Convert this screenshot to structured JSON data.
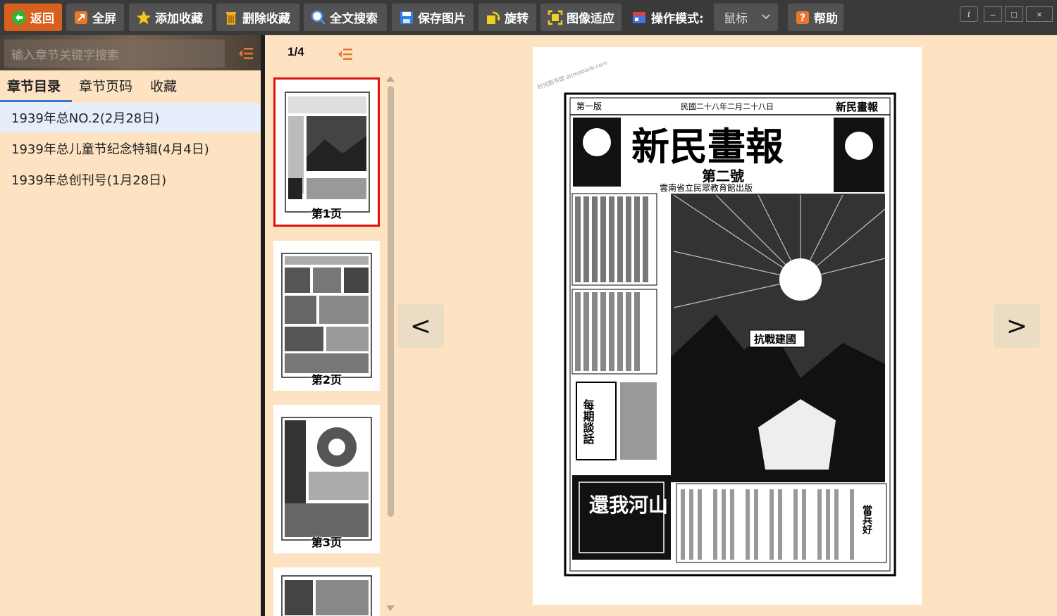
{
  "toolbar": {
    "back": "返回",
    "fullscreen": "全屏",
    "add_favorite": "添加收藏",
    "delete_favorite": "删除收藏",
    "fulltext_search": "全文搜索",
    "save_image": "保存图片",
    "rotate": "旋转",
    "fit_image": "图像适应",
    "operation_mode_label": "操作模式:",
    "operation_mode_value": "鼠标",
    "help": "帮助"
  },
  "window": {
    "info": "i",
    "minimize": "–",
    "maximize": "□",
    "close": "×"
  },
  "sidebar": {
    "search_placeholder": "输入章节关键字搜索",
    "tabs": [
      {
        "label": "章节目录",
        "active": true
      },
      {
        "label": "章节页码",
        "active": false
      },
      {
        "label": "收藏",
        "active": false
      }
    ],
    "chapters": [
      {
        "label": "1939年总NO.2(2月28日)",
        "selected": true
      },
      {
        "label": "1939年总儿童节纪念特辑(4月4日)",
        "selected": false
      },
      {
        "label": "1939年总创刊号(1月28日)",
        "selected": false
      }
    ]
  },
  "thumbnails": {
    "page_count": "1/4",
    "pages": [
      {
        "label": "第1页",
        "selected": true
      },
      {
        "label": "第2页",
        "selected": false
      },
      {
        "label": "第3页",
        "selected": false
      },
      {
        "label": "",
        "selected": false
      }
    ]
  },
  "viewer": {
    "prev": "<",
    "next": ">",
    "newspaper": {
      "masthead": "新民畫報",
      "issue": "第二號",
      "header_left": "新民畫報",
      "header_mid": "民國二十八年二月二十八日",
      "header_right": "第一版",
      "subtitle": "雲南省立民眾教育館出版",
      "banner": "抗戰建國",
      "box_title": "每期談話",
      "slogan": "還我河山",
      "column_title": "當兵好",
      "watermark": "时光图书馆 atimebook.com"
    }
  },
  "colors": {
    "toolbar_bg": "#3a3a3a",
    "button_bg": "#525252",
    "back_button": "#d8601f",
    "panel_bg": "#fde3c2",
    "selected_thumb_border": "#e01010",
    "tab_underline": "#2e78d8"
  }
}
